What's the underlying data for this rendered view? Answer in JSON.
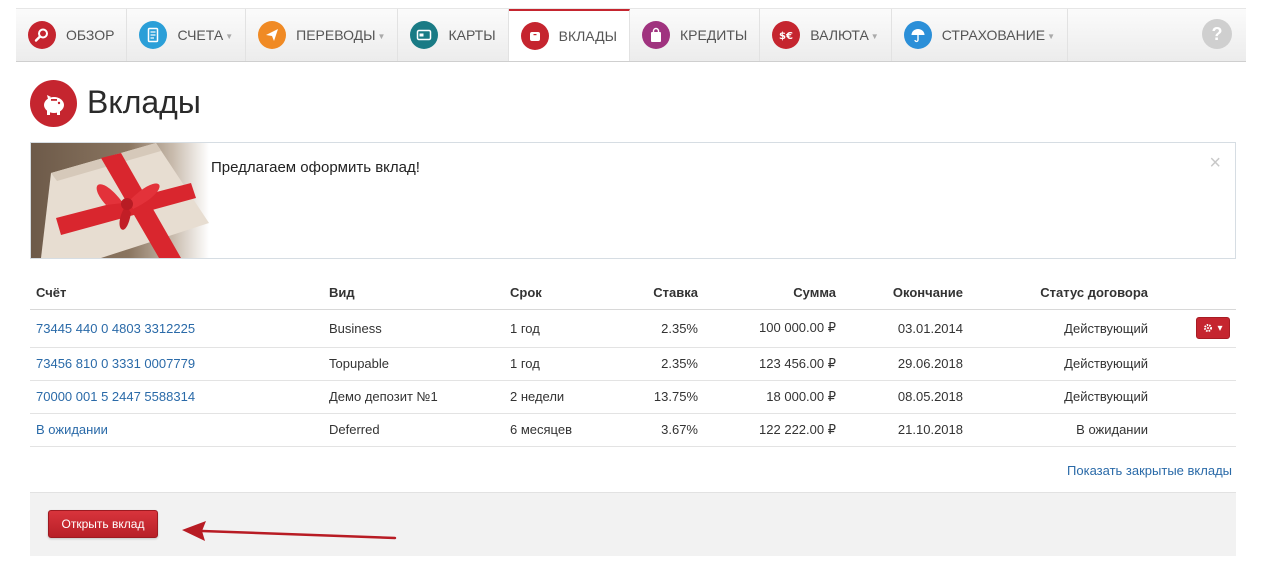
{
  "nav": {
    "items": [
      {
        "label": "Обзор",
        "color": "#c5252f",
        "icon": "search-icon",
        "caret": false,
        "active": false
      },
      {
        "label": "Счета",
        "color": "#2b9fd8",
        "icon": "document-icon",
        "caret": true,
        "active": false
      },
      {
        "label": "Переводы",
        "color": "#f08a24",
        "icon": "paper-plane-icon",
        "caret": true,
        "active": false
      },
      {
        "label": "Карты",
        "color": "#1a7b85",
        "icon": "card-icon",
        "caret": false,
        "active": false
      },
      {
        "label": "Вклады",
        "color": "#c5252f",
        "icon": "piggy-bank-icon",
        "caret": false,
        "active": true
      },
      {
        "label": "Кредиты",
        "color": "#a0337f",
        "icon": "bag-icon",
        "caret": false,
        "active": false
      },
      {
        "label": "Валюта",
        "color": "#c5252f",
        "icon": "currency-icon",
        "caret": true,
        "active": false
      },
      {
        "label": "Страхование",
        "color": "#2b8fd8",
        "icon": "umbrella-icon",
        "caret": true,
        "active": false
      }
    ],
    "help_label": "?"
  },
  "page": {
    "title": "Вклады"
  },
  "promo": {
    "text": "Предлагаем оформить вклад!",
    "close": "×"
  },
  "table": {
    "headers": {
      "account": "Счёт",
      "type": "Вид",
      "term": "Срок",
      "rate": "Ставка",
      "amount": "Сумма",
      "end": "Окончание",
      "status": "Статус договора"
    },
    "rows": [
      {
        "account": "73445 440 0 4803 3312225",
        "type": "Business",
        "term": "1 год",
        "rate": "2.35%",
        "amount": "100 000.00 ₽",
        "end": "03.01.2014",
        "status": "Действующий"
      },
      {
        "account": "73456 810 0 3331 0007779",
        "type": "Topupable",
        "term": "1 год",
        "rate": "2.35%",
        "amount": "123 456.00 ₽",
        "end": "29.06.2018",
        "status": "Действующий"
      },
      {
        "account": "70000 001 5 2447 5588314",
        "type": "Демо депозит №1",
        "term": "2 недели",
        "rate": "13.75%",
        "amount": "18 000.00 ₽",
        "end": "08.05.2018",
        "status": "Действующий"
      },
      {
        "account": "В ожидании",
        "type": "Deferred",
        "term": "6 месяцев",
        "rate": "3.67%",
        "amount": "122 222.00 ₽",
        "end": "21.10.2018",
        "status": "В ожидании"
      }
    ]
  },
  "links": {
    "show_closed": "Показать закрытые вклады"
  },
  "actions": {
    "open_deposit": "Открыть вклад"
  },
  "colors": {
    "brand_red": "#c5252f",
    "link_blue": "#2a6aa8"
  }
}
